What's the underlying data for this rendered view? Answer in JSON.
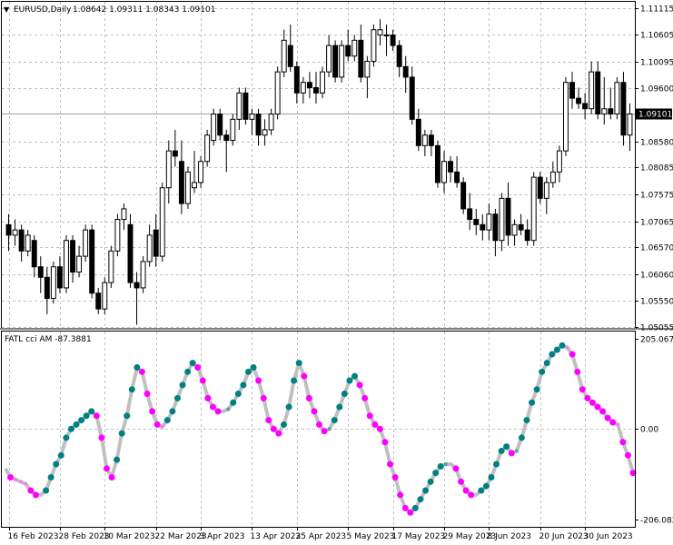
{
  "header": {
    "arrow": "▼",
    "symbol": "EURUSD,Daily",
    "ohlc": "1.08642 1.09311 1.08343 1.09101"
  },
  "indicator": {
    "label": "FATL cci AM -87.3881"
  },
  "colors": {
    "background": "#ffffff",
    "grid": "#c0c0c0",
    "frame": "#000000",
    "separator": "#808080",
    "price_label_bg": "#000000",
    "price_label_text": "#ffffff",
    "line": "#c0c0c0",
    "dot_up": "#008080",
    "dot_down": "#ff00ff",
    "dot_up_light": "#5f9ea0",
    "dot_down_light": "#ee82ee"
  },
  "chart_data": [
    {
      "type": "candlestick",
      "panel": "price",
      "ylim": [
        1.0504,
        1.1123
      ],
      "y_ticks": [
        "1.11115",
        "1.10605",
        "1.10095",
        "1.09600",
        "1.08580",
        "1.08085",
        "1.07575",
        "1.07065",
        "1.06570",
        "1.06060",
        "1.05550",
        "1.05055"
      ],
      "current_price": "1.09101",
      "x_tick_labels": [
        "16 Feb 2023",
        "28 Feb 2023",
        "10 Mar 2023",
        "22 Mar 2023",
        "3 Apr 2023",
        "13 Apr 2023",
        "25 Apr 2023",
        "5 May 2023",
        "17 May 2023",
        "29 May 2023",
        "8 Jun 2023",
        "20 Jun 2023",
        "30 Jun 2023"
      ],
      "candles": [
        [
          1.07,
          1.072,
          1.065,
          1.068
        ],
        [
          1.068,
          1.071,
          1.066,
          1.069
        ],
        [
          1.069,
          1.07,
          1.063,
          1.065
        ],
        [
          1.065,
          1.069,
          1.064,
          1.068
        ],
        [
          1.067,
          1.068,
          1.06,
          1.062
        ],
        [
          1.062,
          1.064,
          1.057,
          1.06
        ],
        [
          1.06,
          1.062,
          1.053,
          1.056
        ],
        [
          1.056,
          1.063,
          1.055,
          1.062
        ],
        [
          1.062,
          1.064,
          1.057,
          1.058
        ],
        [
          1.058,
          1.068,
          1.057,
          1.067
        ],
        [
          1.067,
          1.068,
          1.059,
          1.061
        ],
        [
          1.061,
          1.066,
          1.06,
          1.064
        ],
        [
          1.064,
          1.07,
          1.063,
          1.069
        ],
        [
          1.069,
          1.07,
          1.056,
          1.057
        ],
        [
          1.057,
          1.058,
          1.053,
          1.054
        ],
        [
          1.054,
          1.06,
          1.053,
          1.059
        ],
        [
          1.059,
          1.066,
          1.058,
          1.065
        ],
        [
          1.065,
          1.072,
          1.064,
          1.071
        ],
        [
          1.071,
          1.074,
          1.069,
          1.073
        ],
        [
          1.07,
          1.072,
          1.058,
          1.059
        ],
        [
          1.059,
          1.061,
          1.051,
          1.058
        ],
        [
          1.058,
          1.064,
          1.057,
          1.063
        ],
        [
          1.063,
          1.07,
          1.062,
          1.068
        ],
        [
          1.069,
          1.072,
          1.062,
          1.064
        ],
        [
          1.064,
          1.078,
          1.063,
          1.077
        ],
        [
          1.077,
          1.086,
          1.074,
          1.084
        ],
        [
          1.084,
          1.088,
          1.081,
          1.083
        ],
        [
          1.082,
          1.086,
          1.072,
          1.074
        ],
        [
          1.074,
          1.081,
          1.073,
          1.08
        ],
        [
          1.077,
          1.084,
          1.076,
          1.078
        ],
        [
          1.078,
          1.083,
          1.077,
          1.082
        ],
        [
          1.082,
          1.088,
          1.081,
          1.087
        ],
        [
          1.086,
          1.092,
          1.085,
          1.091
        ],
        [
          1.091,
          1.092,
          1.086,
          1.087
        ],
        [
          1.087,
          1.088,
          1.08,
          1.086
        ],
        [
          1.086,
          1.091,
          1.085,
          1.09
        ],
        [
          1.09,
          1.096,
          1.088,
          1.095
        ],
        [
          1.095,
          1.096,
          1.089,
          1.09
        ],
        [
          1.09,
          1.092,
          1.087,
          1.091
        ],
        [
          1.091,
          1.092,
          1.085,
          1.087
        ],
        [
          1.087,
          1.09,
          1.085,
          1.088
        ],
        [
          1.088,
          1.092,
          1.087,
          1.091
        ],
        [
          1.091,
          1.1,
          1.09,
          1.099
        ],
        [
          1.099,
          1.107,
          1.098,
          1.105
        ],
        [
          1.104,
          1.108,
          1.099,
          1.1
        ],
        [
          1.1,
          1.101,
          1.093,
          1.095
        ],
        [
          1.095,
          1.098,
          1.093,
          1.097
        ],
        [
          1.097,
          1.099,
          1.094,
          1.096
        ],
        [
          1.096,
          1.099,
          1.093,
          1.095
        ],
        [
          1.095,
          1.1,
          1.094,
          1.099
        ],
        [
          1.099,
          1.106,
          1.098,
          1.104
        ],
        [
          1.104,
          1.105,
          1.097,
          1.098
        ],
        [
          1.098,
          1.105,
          1.097,
          1.104
        ],
        [
          1.104,
          1.107,
          1.101,
          1.102
        ],
        [
          1.102,
          1.106,
          1.101,
          1.105
        ],
        [
          1.105,
          1.108,
          1.097,
          1.098
        ],
        [
          1.098,
          1.102,
          1.094,
          1.101
        ],
        [
          1.101,
          1.108,
          1.1,
          1.107
        ],
        [
          1.106,
          1.109,
          1.104,
          1.107
        ],
        [
          1.106,
          1.108,
          1.102,
          1.106
        ],
        [
          1.106,
          1.107,
          1.103,
          1.104
        ],
        [
          1.104,
          1.105,
          1.098,
          1.1
        ],
        [
          1.1,
          1.102,
          1.095,
          1.098
        ],
        [
          1.098,
          1.1,
          1.089,
          1.09
        ],
        [
          1.09,
          1.092,
          1.084,
          1.085
        ],
        [
          1.085,
          1.088,
          1.083,
          1.087
        ],
        [
          1.087,
          1.088,
          1.083,
          1.085
        ],
        [
          1.085,
          1.086,
          1.077,
          1.078
        ],
        [
          1.078,
          1.084,
          1.076,
          1.082
        ],
        [
          1.082,
          1.083,
          1.078,
          1.08
        ],
        [
          1.08,
          1.083,
          1.077,
          1.078
        ],
        [
          1.078,
          1.079,
          1.072,
          1.073
        ],
        [
          1.073,
          1.076,
          1.069,
          1.071
        ],
        [
          1.071,
          1.073,
          1.068,
          1.07
        ],
        [
          1.07,
          1.072,
          1.067,
          1.069
        ],
        [
          1.069,
          1.074,
          1.067,
          1.072
        ],
        [
          1.072,
          1.073,
          1.064,
          1.067
        ],
        [
          1.067,
          1.076,
          1.065,
          1.075
        ],
        [
          1.075,
          1.078,
          1.066,
          1.068
        ],
        [
          1.068,
          1.071,
          1.066,
          1.07
        ],
        [
          1.07,
          1.072,
          1.068,
          1.069
        ],
        [
          1.069,
          1.071,
          1.066,
          1.067
        ],
        [
          1.067,
          1.08,
          1.066,
          1.079
        ],
        [
          1.079,
          1.08,
          1.074,
          1.075
        ],
        [
          1.075,
          1.079,
          1.072,
          1.078
        ],
        [
          1.078,
          1.082,
          1.077,
          1.08
        ],
        [
          1.08,
          1.085,
          1.078,
          1.084
        ],
        [
          1.084,
          1.098,
          1.083,
          1.097
        ],
        [
          1.097,
          1.099,
          1.092,
          1.094
        ],
        [
          1.094,
          1.096,
          1.092,
          1.093
        ],
        [
          1.093,
          1.095,
          1.09,
          1.092
        ],
        [
          1.092,
          1.101,
          1.091,
          1.099
        ],
        [
          1.099,
          1.101,
          1.09,
          1.091
        ],
        [
          1.091,
          1.098,
          1.089,
          1.092
        ],
        [
          1.092,
          1.096,
          1.09,
          1.091
        ],
        [
          1.091,
          1.098,
          1.09,
          1.097
        ],
        [
          1.097,
          1.099,
          1.085,
          1.087
        ],
        [
          1.087,
          1.093,
          1.084,
          1.091
        ]
      ]
    },
    {
      "type": "line",
      "panel": "indicator",
      "ylim": [
        -206.0821,
        205.0677
      ],
      "y_ticks": [
        "205.0677",
        "0.00",
        "-206.0821"
      ],
      "values": [
        -90,
        -110,
        -115,
        -120,
        -125,
        -140,
        -150,
        -150,
        -140,
        -110,
        -80,
        -60,
        -20,
        0,
        10,
        20,
        30,
        40,
        30,
        -20,
        -90,
        -110,
        -70,
        -10,
        30,
        90,
        140,
        130,
        80,
        40,
        10,
        5,
        20,
        40,
        70,
        100,
        130,
        150,
        140,
        110,
        70,
        50,
        40,
        40,
        45,
        60,
        80,
        100,
        130,
        140,
        110,
        70,
        20,
        0,
        -10,
        10,
        50,
        110,
        150,
        120,
        70,
        40,
        10,
        -5,
        0,
        20,
        50,
        80,
        110,
        120,
        100,
        70,
        30,
        10,
        0,
        -30,
        -80,
        -110,
        -150,
        -180,
        -190,
        -180,
        -160,
        -140,
        -120,
        -100,
        -85,
        -80,
        -80,
        -90,
        -120,
        -140,
        -150,
        -150,
        -140,
        -130,
        -110,
        -80,
        -50,
        -40,
        -55,
        -50,
        -20,
        20,
        60,
        90,
        130,
        150,
        170,
        180,
        190,
        185,
        170,
        130,
        90,
        70,
        60,
        50,
        40,
        25,
        15,
        10,
        -30,
        -60,
        -100
      ]
    }
  ]
}
